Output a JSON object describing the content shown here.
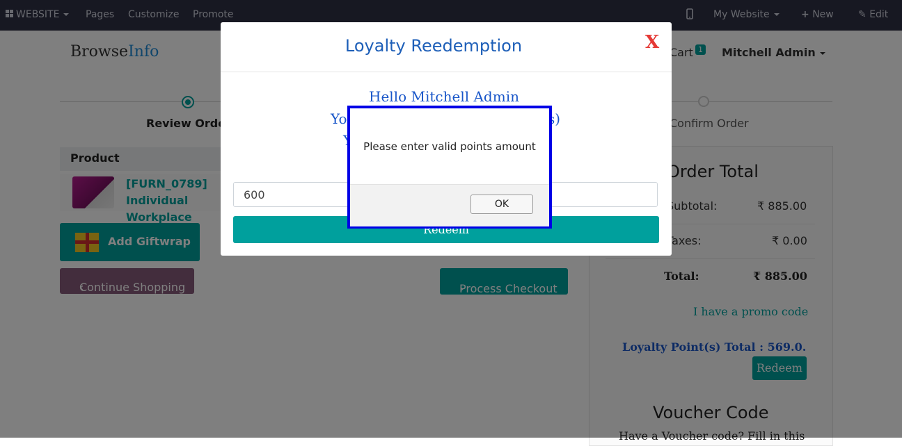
{
  "topbar": {
    "website": "WEBSITE",
    "pages": "Pages",
    "customize": "Customize",
    "promote": "Promote",
    "my_website": "My Website",
    "new": "New",
    "edit": "Edit",
    "icons": [
      "apps-grid-icon",
      "mobile-icon",
      "plus-icon",
      "pencil-icon"
    ]
  },
  "header": {
    "brand_part1": "Browse",
    "brand_part2": "Info",
    "cart": "Cart",
    "cart_count": "1",
    "user": "Mitchell Admin"
  },
  "steps": {
    "step1": "Review Order",
    "step3": "Confirm Order"
  },
  "cart": {
    "product_header": "Product",
    "product_name": "[FURN_0789] Individual Workplace",
    "add_giftwrap": "Add Giftwrap",
    "continue_shopping": "Continue Shopping",
    "process_checkout": "Process Checkout"
  },
  "order_total": {
    "title": "Order Total",
    "subtotal_label": "Subtotal:",
    "subtotal_value": "₹ 885.00",
    "taxes_label": "Taxes:",
    "taxes_value": "₹ 0.00",
    "total_label": "Total:",
    "total_value": "₹ 885.00",
    "promo_link": "I have a promo code",
    "loyalty_total": "Loyalty Point(s) Total : 569.0.",
    "redeem": "Redeem",
    "voucher_title": "Voucher Code",
    "voucher_hint": "Have a Voucher code? Fill in this"
  },
  "modal": {
    "title": "Loyalty Reedemption",
    "close": "X",
    "hello": "Hello Mitchell Admin",
    "points_line_left": "Yo",
    "points_line_right": "s)",
    "line3_left": "Y",
    "points_input": "600",
    "redeem": "Redeem"
  },
  "alert": {
    "message": "Please enter valid points amount",
    "ok": "OK"
  },
  "colors": {
    "topbar": "#2e3044",
    "accent": "#00a09d",
    "secondary": "#875a7b",
    "link_blue": "#1a57c9",
    "close_red": "#e53935",
    "alert_border": "#0000e6"
  }
}
